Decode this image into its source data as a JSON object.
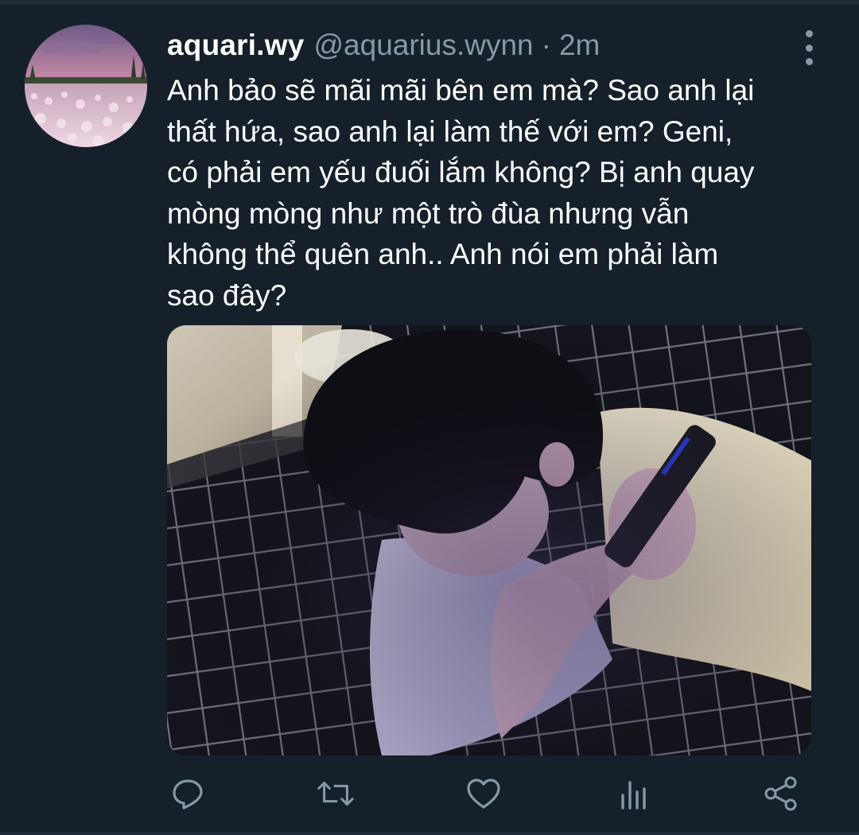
{
  "tweet": {
    "display_name": "aquari.wy",
    "handle": "@aquarius.wynn",
    "separator": "·",
    "timestamp": "2m",
    "text": "Anh bảo sẽ mãi mãi bên em mà? Sao anh lại\nthất hứa, sao anh lại làm thế với em? Geni,\ncó phải em yếu đuối lắm không? Bị anh quay\nmòng mòng như một trò đùa nhưng vẫn\nkhông thể quên anh.. Anh nói em phải làm\nsao đây?"
  },
  "icons": {
    "avatar": "avatar-image",
    "more": "more-options-icon",
    "reply": "reply-icon",
    "retweet": "retweet-icon",
    "like": "heart-icon",
    "analytics": "analytics-icon",
    "share": "share-icon"
  },
  "colors": {
    "background": "#15202b",
    "text_primary": "#ffffff",
    "text_secondary": "#8899a6",
    "divider": "#1e2a36"
  }
}
